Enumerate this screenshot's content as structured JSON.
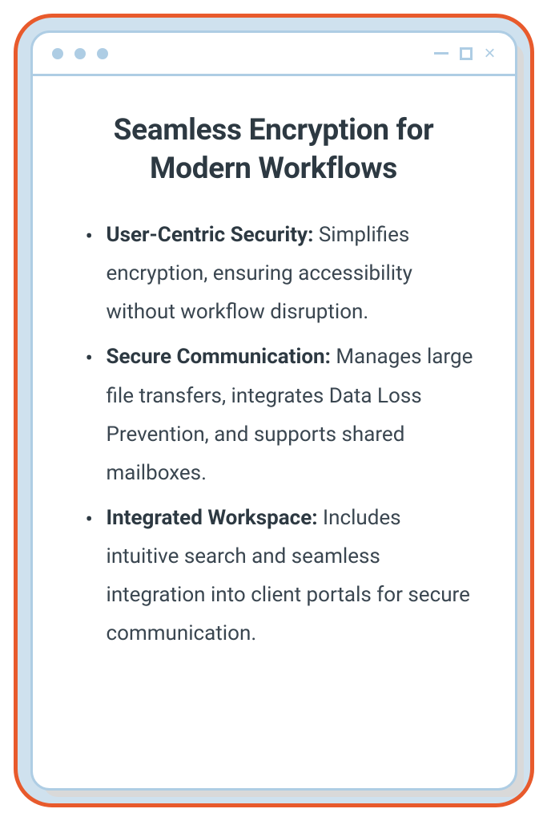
{
  "heading": "Seamless Encryption for Modern Workflows",
  "bullets": [
    {
      "label": "User-Centric Security:",
      "text": " Simplifies encryption, ensuring accessibility without workflow disruption."
    },
    {
      "label": "Secure Communication:",
      "text": " Manages large file transfers, integrates Data Loss Prevention, and supports shared mailboxes."
    },
    {
      "label": "Integrated Workspace:",
      "text": " Includes intuitive search and seamless integration into client portals for secure communication."
    }
  ]
}
